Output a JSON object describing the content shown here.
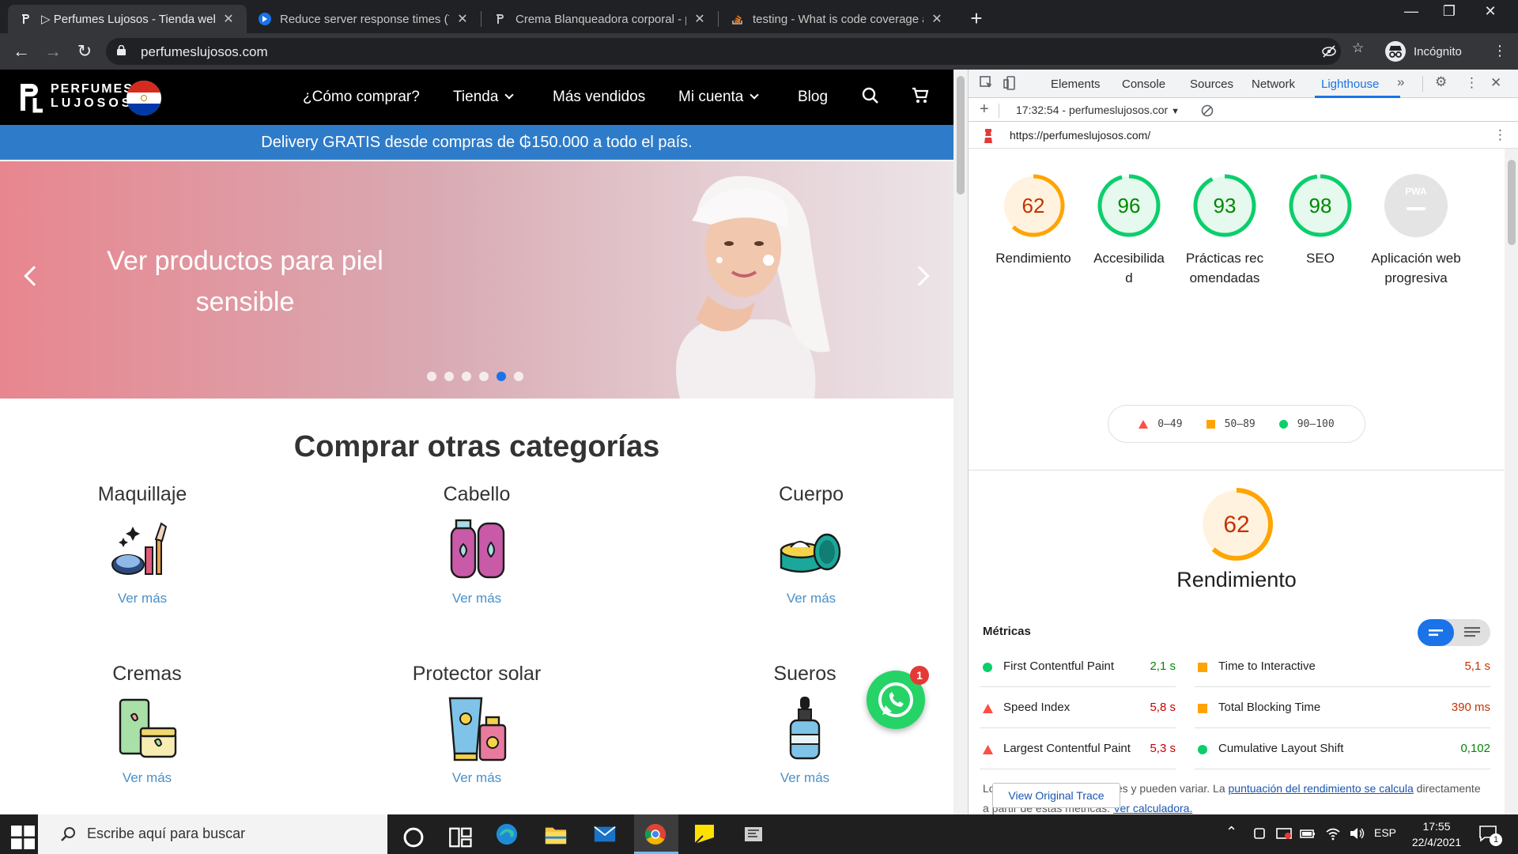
{
  "tabs": [
    {
      "title": "▷ Perfumes Lujosos - Tienda web",
      "active": true
    },
    {
      "title": "Reduce server response times (T",
      "active": false
    },
    {
      "title": "Crema Blanqueadora corporal - p",
      "active": false
    },
    {
      "title": "testing - What is code coverage a",
      "active": false
    }
  ],
  "toolbar": {
    "url": "perfumeslujosos.com",
    "profile_label": "Incógnito"
  },
  "site": {
    "logo_line1": "PERFUMES",
    "logo_line2": "LUJOSOS",
    "menu": [
      "¿Cómo comprar?",
      "Tienda",
      "Más vendidos",
      "Mi cuenta",
      "Blog"
    ],
    "promo": "Delivery GRATIS desde compras de ₲150.000 a todo el país.",
    "hero_text": "Ver productos para piel sensible",
    "hero_active_dot": 4,
    "hero_dot_count": 6,
    "section_title": "Comprar otras categorías",
    "categories": [
      {
        "name": "Maquillaje",
        "link": "Ver más"
      },
      {
        "name": "Cabello",
        "link": "Ver más"
      },
      {
        "name": "Cuerpo",
        "link": "Ver más"
      },
      {
        "name": "Cremas",
        "link": "Ver más"
      },
      {
        "name": "Protector solar",
        "link": "Ver más"
      },
      {
        "name": "Sueros",
        "link": "Ver más"
      }
    ],
    "whatsapp_badge": "1"
  },
  "devtools": {
    "tabs": [
      "Elements",
      "Console",
      "Sources",
      "Network",
      "Lighthouse"
    ],
    "active_tab": "Lighthouse",
    "report_select": "17:32:54 - perfumeslujosos.cor",
    "report_url": "https://perfumeslujosos.com/",
    "scores": [
      {
        "value": 62,
        "label": "Rendimiento",
        "status": "average"
      },
      {
        "value": 96,
        "label": "Accesibilidad",
        "status": "pass"
      },
      {
        "value": 93,
        "label": "Prácticas recomendadas",
        "status": "pass"
      },
      {
        "value": 98,
        "label": "SEO",
        "status": "pass"
      },
      {
        "value": null,
        "label": "Aplicación web progresiva",
        "status": "na",
        "badge": "PWA"
      }
    ],
    "legend": [
      {
        "range": "0–49",
        "status": "fail"
      },
      {
        "range": "50–89",
        "status": "average"
      },
      {
        "range": "90–100",
        "status": "pass"
      }
    ],
    "perf_score": 62,
    "perf_label": "Rendimiento",
    "metrics_title": "Métricas",
    "metrics": [
      {
        "name": "First Contentful Paint",
        "value": "2,1 s",
        "status": "pass"
      },
      {
        "name": "Time to Interactive",
        "value": "5,1 s",
        "status": "average"
      },
      {
        "name": "Speed Index",
        "value": "5,8 s",
        "status": "fail"
      },
      {
        "name": "Total Blocking Time",
        "value": "390 ms",
        "status": "average"
      },
      {
        "name": "Largest Contentful Paint",
        "value": "5,3 s",
        "status": "fail"
      },
      {
        "name": "Cumulative Layout Shift",
        "value": "0,102",
        "status": "pass"
      }
    ],
    "note_prefix": "Los valores son estimaciones y pueden variar. La ",
    "note_link1": "puntuación del rendimiento se calcula",
    "note_mid": " directamente a partir de estas métricas. ",
    "note_link2": "Ver calculadora.",
    "trace_button": "View Original Trace"
  },
  "taskbar": {
    "search_placeholder": "Escribe aquí para buscar",
    "language": "ESP",
    "time": "17:55",
    "date": "22/4/2021",
    "notif_count": "1"
  },
  "colors": {
    "pass": "#0cce6b",
    "average": "#ffa400",
    "fail": "#ff4e42",
    "pass_text": "#008800",
    "average_text": "#c33300",
    "fail_text": "#cc0000",
    "promo": "#2e7cc9",
    "accent": "#1a73e8"
  }
}
